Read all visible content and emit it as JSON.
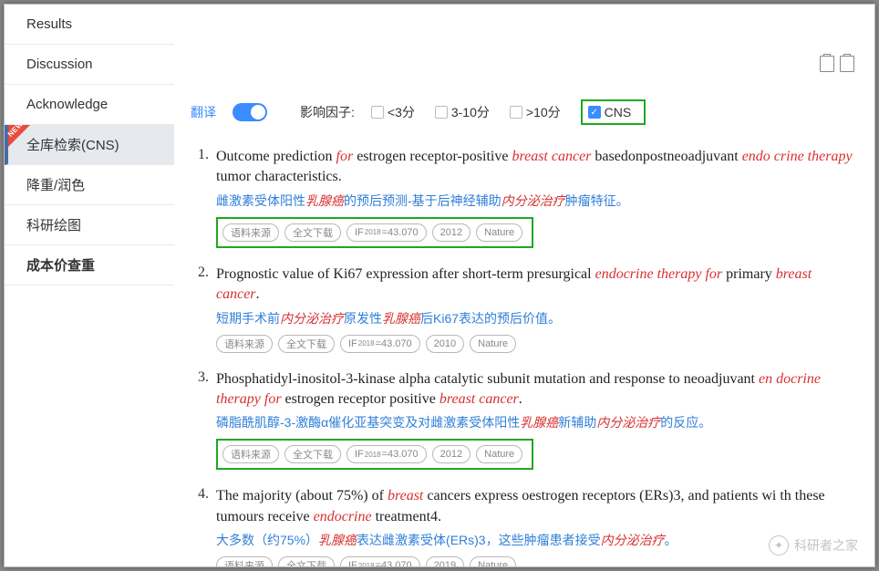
{
  "sidebar": {
    "items": [
      {
        "label": "Results"
      },
      {
        "label": "Discussion"
      },
      {
        "label": "Acknowledge"
      },
      {
        "label": "全库检索(CNS)",
        "active": true,
        "new": true
      },
      {
        "label": "降重/润色"
      },
      {
        "label": "科研绘图"
      },
      {
        "label": "成本价查重",
        "bold": true
      }
    ]
  },
  "filters": {
    "translate_label": "翻译",
    "translate_on": true,
    "if_label": "影响因子:",
    "opts": [
      {
        "label": "<3分",
        "checked": false
      },
      {
        "label": "3-10分",
        "checked": false
      },
      {
        "label": ">10分",
        "checked": false
      },
      {
        "label": "CNS",
        "checked": true,
        "highlight": true
      }
    ]
  },
  "tag_labels": {
    "source": "语料来源",
    "download": "全文下载",
    "if_prefix": "IF",
    "if_year": "2018"
  },
  "results": [
    {
      "num": "1.",
      "title_segments": [
        {
          "t": "Outcome prediction "
        },
        {
          "t": "for",
          "cls": "hl-red"
        },
        {
          "t": " estrogen receptor-positive "
        },
        {
          "t": "breast cancer",
          "cls": "hl-red-b"
        },
        {
          "t": " basedonpostneoadjuvant "
        },
        {
          "t": "endo crine therapy",
          "cls": "hl-red"
        },
        {
          "t": " tumor characteristics."
        }
      ],
      "translation_segments": [
        {
          "t": "雌激素受体阳性"
        },
        {
          "t": "乳腺癌",
          "cls": "t-em"
        },
        {
          "t": "的预后预测-基于后神经辅助"
        },
        {
          "t": "内分泌治疗",
          "cls": "t-em"
        },
        {
          "t": "肿瘤特征。"
        }
      ],
      "if_value": "=43.070",
      "year": "2012",
      "journal": "Nature",
      "tags_highlight": true
    },
    {
      "num": "2.",
      "title_segments": [
        {
          "t": "Prognostic value of Ki67 expression after short-term presurgical "
        },
        {
          "t": "endocrine therapy for",
          "cls": "hl-red"
        },
        {
          "t": " primary "
        },
        {
          "t": "breast cancer",
          "cls": "hl-red-b"
        },
        {
          "t": "."
        }
      ],
      "translation_segments": [
        {
          "t": "短期手术前"
        },
        {
          "t": "内分泌治疗",
          "cls": "t-em"
        },
        {
          "t": "原发性"
        },
        {
          "t": "乳腺癌",
          "cls": "t-em"
        },
        {
          "t": "后Ki67表达的预后价值。"
        }
      ],
      "if_value": "=43.070",
      "year": "2010",
      "journal": "Nature",
      "tags_highlight": false
    },
    {
      "num": "3.",
      "title_segments": [
        {
          "t": "Phosphatidyl-inositol-3-kinase alpha catalytic subunit mutation and response to neoadjuvant "
        },
        {
          "t": "en docrine therapy for",
          "cls": "hl-red"
        },
        {
          "t": " estrogen receptor positive "
        },
        {
          "t": "breast cancer",
          "cls": "hl-red-b"
        },
        {
          "t": "."
        }
      ],
      "translation_segments": [
        {
          "t": "磷脂酰肌醇-3-激酶α催化亚基突变及对雌激素受体阳性"
        },
        {
          "t": "乳腺癌",
          "cls": "t-em"
        },
        {
          "t": "新辅助"
        },
        {
          "t": "内分泌治疗",
          "cls": "t-em"
        },
        {
          "t": "的反应。"
        }
      ],
      "if_value": "=43.070",
      "year": "2012",
      "journal": "Nature",
      "tags_highlight": true
    },
    {
      "num": "4.",
      "title_segments": [
        {
          "t": "The majority (about 75%) of "
        },
        {
          "t": "breast",
          "cls": "hl-red-b"
        },
        {
          "t": " cancers express oestrogen receptors (ERs)3, and patients wi th these tumours receive "
        },
        {
          "t": "endocrine",
          "cls": "hl-red"
        },
        {
          "t": " treatment4."
        }
      ],
      "translation_segments": [
        {
          "t": "大多数（约75%）"
        },
        {
          "t": "乳腺癌",
          "cls": "t-em"
        },
        {
          "t": "表达雌激素受体(ERs)3，这些肿瘤患者接受"
        },
        {
          "t": "内分泌治疗",
          "cls": "t-em"
        },
        {
          "t": "。"
        }
      ],
      "if_value": "=43.070",
      "year": "2019",
      "journal": "Nature",
      "tags_highlight": false
    }
  ],
  "watermark": "科研者之家"
}
